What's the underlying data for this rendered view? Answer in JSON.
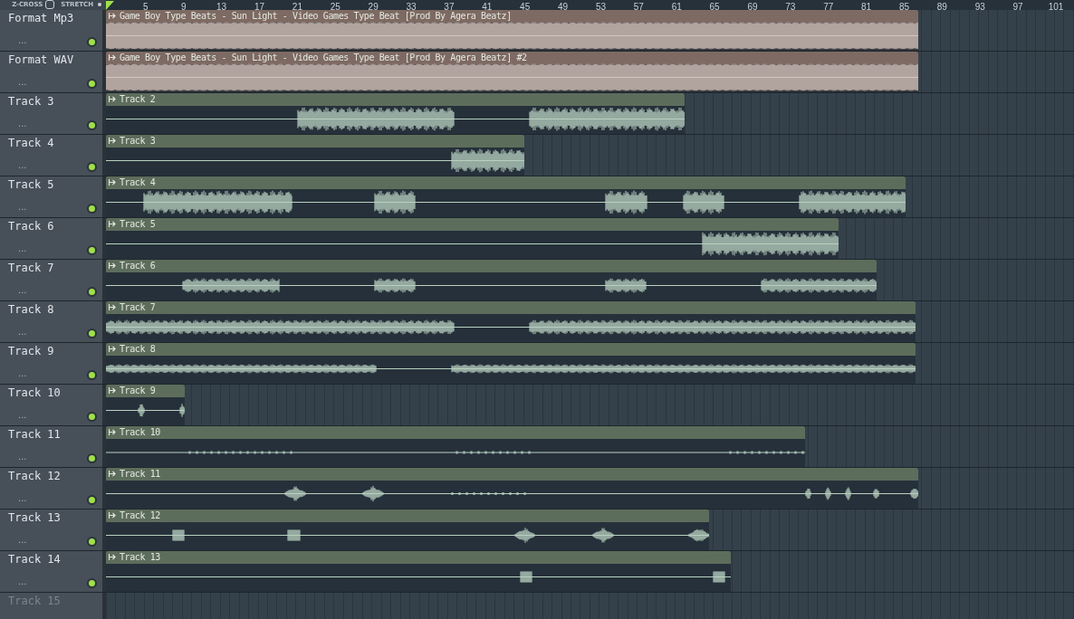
{
  "toolbar": {
    "zcross_label": "Z-CROSS",
    "zcross_on": false,
    "stretch_label": "STRETCH"
  },
  "ruler": {
    "labels": [
      "5",
      "9",
      "13",
      "17",
      "21",
      "25",
      "29",
      "33",
      "37",
      "41",
      "45",
      "49",
      "53",
      "57",
      "61",
      "65",
      "69",
      "73",
      "77",
      "81",
      "85",
      "89",
      "93",
      "97",
      "101"
    ]
  },
  "tracks": [
    {
      "name": "Format Mp3",
      "dots": "...",
      "enabled": true,
      "clip": {
        "label": "Game Boy Type Beats - Sun Light - Video Games Type Beat [Prod By Agera Beatz]",
        "color": "#7d6a63"
      }
    },
    {
      "name": "Format WAV",
      "dots": "...",
      "enabled": true,
      "clip": {
        "label": "Game Boy Type Beats - Sun Light - Video Games Type Beat [Prod By Agera Beatz] #2",
        "color": "#7d6a63"
      }
    },
    {
      "name": "Track 3",
      "dots": "...",
      "enabled": true,
      "clip": {
        "label": "Track 2",
        "color": "#5d6d5c"
      }
    },
    {
      "name": "Track 4",
      "dots": "...",
      "enabled": true,
      "clip": {
        "label": "Track 3",
        "color": "#5d6d5c"
      }
    },
    {
      "name": "Track 5",
      "dots": "...",
      "enabled": true,
      "clip": {
        "label": "Track 4",
        "color": "#5d6d5c"
      }
    },
    {
      "name": "Track 6",
      "dots": "...",
      "enabled": true,
      "clip": {
        "label": "Track 5",
        "color": "#5d6d5c"
      }
    },
    {
      "name": "Track 7",
      "dots": "...",
      "enabled": true,
      "clip": {
        "label": "Track 6",
        "color": "#5d6d5c"
      }
    },
    {
      "name": "Track 8",
      "dots": "...",
      "enabled": true,
      "clip": {
        "label": "Track 7",
        "color": "#5d6d5c"
      }
    },
    {
      "name": "Track 9",
      "dots": "...",
      "enabled": true,
      "clip": {
        "label": "Track 8",
        "color": "#5d6d5c"
      }
    },
    {
      "name": "Track 10",
      "dots": "...",
      "enabled": true,
      "clip": {
        "label": "Track 9",
        "color": "#5d6d5c"
      }
    },
    {
      "name": "Track 11",
      "dots": "...",
      "enabled": true,
      "clip": {
        "label": "Track 10",
        "color": "#5d6d5c"
      }
    },
    {
      "name": "Track 12",
      "dots": "...",
      "enabled": true,
      "clip": {
        "label": "Track 11",
        "color": "#5d6d5c"
      }
    },
    {
      "name": "Track 13",
      "dots": "...",
      "enabled": true,
      "clip": {
        "label": "Track 12",
        "color": "#5d6d5c"
      }
    },
    {
      "name": "Track 14",
      "dots": "...",
      "enabled": true,
      "clip": {
        "label": "Track 13",
        "color": "#5d6d5c"
      }
    },
    {
      "name": "Track 15"
    }
  ]
}
